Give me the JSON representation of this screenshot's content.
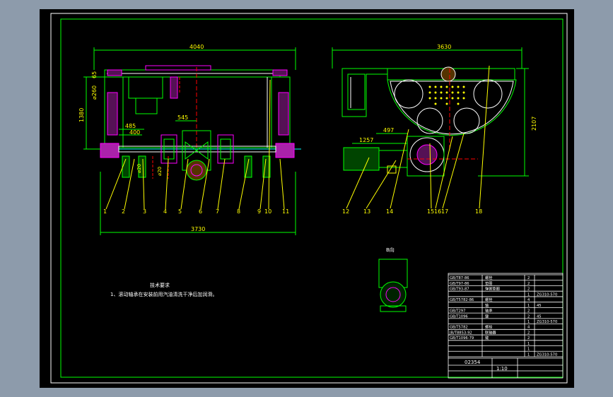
{
  "drawing": {
    "front_view": {
      "dims": {
        "overall_top": "4040",
        "overall_bottom": "3730",
        "diameter": "⌀260",
        "height": "1380",
        "d1": "485",
        "d2": "400",
        "d3": "545",
        "small_dia_1": "⌀20",
        "small_dia_2": "⌀20",
        "left_top": "65"
      },
      "balloons": [
        "1",
        "2",
        "3",
        "4",
        "5",
        "6",
        "7",
        "8",
        "9",
        "10",
        "11"
      ]
    },
    "side_view": {
      "dims": {
        "overall_top": "3630",
        "height": "2107",
        "d1": "497",
        "d2": "1257"
      },
      "balloons": [
        "12",
        "13",
        "14",
        "15",
        "16",
        "17",
        "18"
      ]
    },
    "view_b": {
      "label": "B向"
    },
    "tech_notes": {
      "title": "技术要求",
      "items": [
        "1、滚动轴承在安装前用汽油清洗干净后加润滑。"
      ]
    },
    "title_block": {
      "drawing_no": "02354",
      "scale": "1:10",
      "parts_rows": [
        {
          "code": "GB/T87-86",
          "name": "螺栓",
          "qty": "2",
          "mat": ""
        },
        {
          "code": "GB/T97-86",
          "name": "垫圈",
          "qty": "2",
          "mat": ""
        },
        {
          "code": "GB/T93-87",
          "name": "弹簧垫圈",
          "qty": "2",
          "mat": ""
        },
        {
          "code": "",
          "name": "",
          "qty": "1",
          "mat": "ZG310-570"
        },
        {
          "code": "GB/T5782-86",
          "name": "螺栓",
          "qty": "4",
          "mat": ""
        },
        {
          "code": "",
          "name": "轴",
          "qty": "1",
          "mat": "45"
        },
        {
          "code": "GB/T297",
          "name": "轴承",
          "qty": "2",
          "mat": ""
        },
        {
          "code": "GB/T1096",
          "name": "键",
          "qty": "2",
          "mat": "45"
        },
        {
          "code": "",
          "name": "",
          "qty": "1",
          "mat": "ZG310-570"
        },
        {
          "code": "GB/T5782",
          "name": "螺栓",
          "qty": "4",
          "mat": ""
        },
        {
          "code": "JB/T8853-92",
          "name": "联轴器",
          "qty": "2",
          "mat": ""
        },
        {
          "code": "GB/T1096-79",
          "name": "键",
          "qty": "2",
          "mat": ""
        },
        {
          "code": "",
          "name": "",
          "qty": "1",
          "mat": ""
        },
        {
          "code": "",
          "name": "",
          "qty": "1",
          "mat": ""
        },
        {
          "code": "",
          "name": "",
          "qty": "1",
          "mat": "ZG310-570"
        }
      ]
    }
  }
}
